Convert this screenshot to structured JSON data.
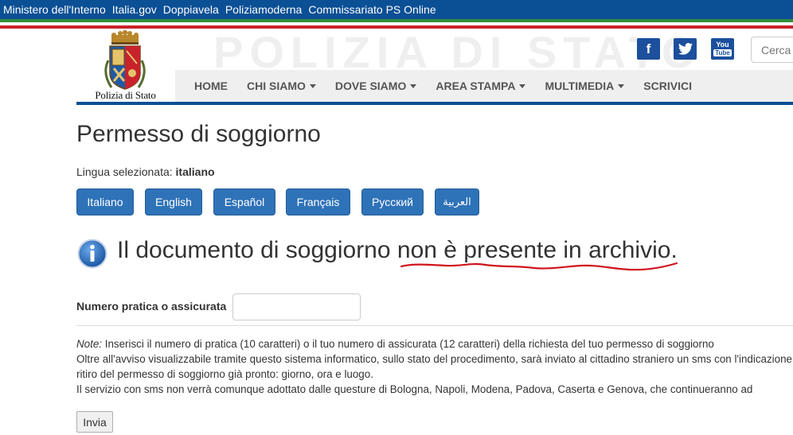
{
  "topbar": {
    "links": [
      "Ministero dell'Interno",
      "Italia.gov",
      "Doppiavela",
      "Poliziamoderna",
      "Commissariato PS Online"
    ]
  },
  "brand": {
    "watermark": "POLIZIA DI STATO",
    "logo_caption": "Polizia di Stato"
  },
  "social": {
    "facebook": "f",
    "youtube_line1": "You",
    "youtube_line2": "Tube"
  },
  "search": {
    "placeholder": "Cerca"
  },
  "nav": {
    "items": [
      {
        "label": "HOME",
        "dropdown": false
      },
      {
        "label": "CHI SIAMO",
        "dropdown": true
      },
      {
        "label": "DOVE SIAMO",
        "dropdown": true
      },
      {
        "label": "AREA STAMPA",
        "dropdown": true
      },
      {
        "label": "MULTIMEDIA",
        "dropdown": true
      },
      {
        "label": "SCRIVICI",
        "dropdown": false
      }
    ]
  },
  "page": {
    "title": "Permesso di soggiorno",
    "lang_prefix": "Lingua selezionata: ",
    "lang_selected": "italiano",
    "languages": [
      "Italiano",
      "English",
      "Español",
      "Français",
      "Русский",
      "العربية"
    ]
  },
  "message": {
    "text_a": "Il documento di soggiorno ",
    "text_b": "non è presente in archivio."
  },
  "form": {
    "label": "Numero pratica o assicurata",
    "input_value": "",
    "submit_label": "Invia"
  },
  "notes": {
    "note_label": "Note:",
    "line1": " Inserisci il numero di pratica (10 caratteri) o il tuo numero di assicurata (12 caratteri) della richiesta del tuo permesso di soggiorno",
    "line2": "Oltre all'avviso visualizzabile tramite questo sistema informatico, sullo stato del procedimento, sarà inviato al cittadino straniero un sms con l'indicazione",
    "line3": "ritiro del permesso di soggiorno già pronto: giorno, ora e luogo.",
    "line4": "Il servizio con sms non verrà comunque adottato dalle questure di Bologna, Napoli, Modena, Padova, Caserta e Genova, che continueranno ad"
  },
  "colors": {
    "topbar": "#0b4f95",
    "lang_button": "#2e72b8",
    "social": "#1c4f9c",
    "squiggle": "#d0141c"
  }
}
